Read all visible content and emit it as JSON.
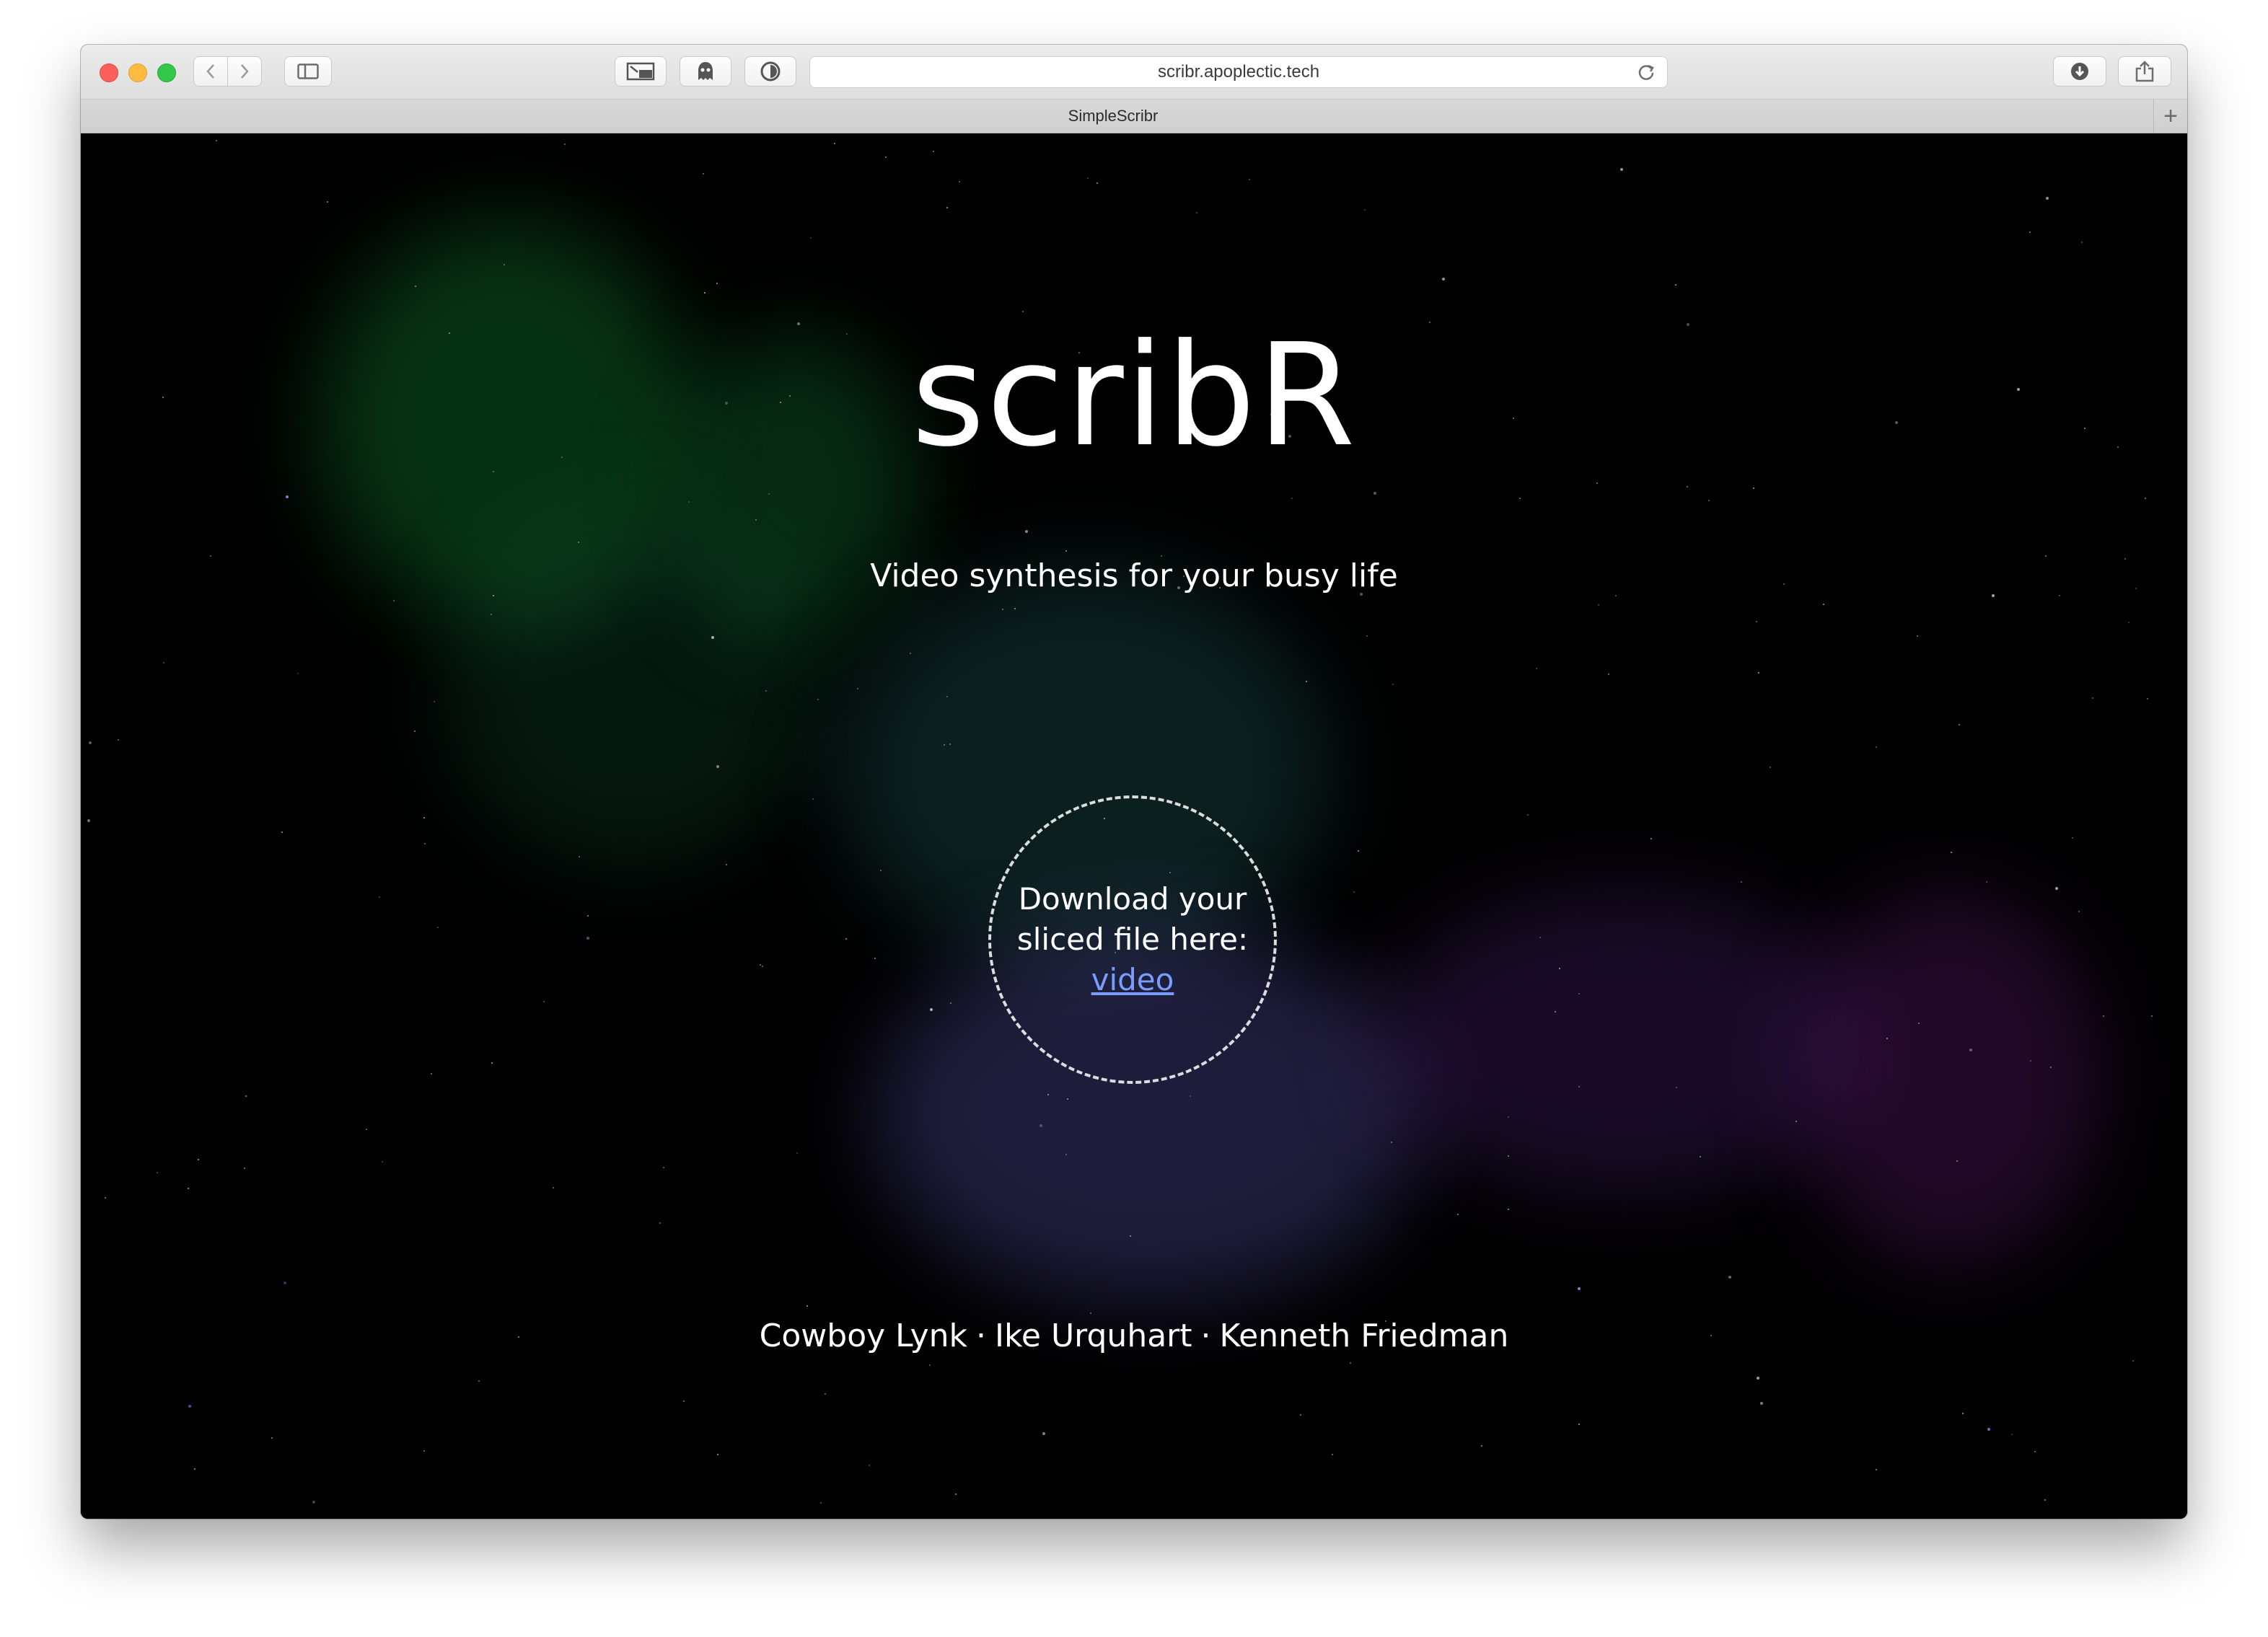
{
  "browser": {
    "url": "scribr.apoplectic.tech",
    "tab_title": "SimpleScribr",
    "new_tab_label": "+"
  },
  "page": {
    "title": "scribR",
    "tagline": "Video synthesis for your busy life",
    "download_line1": "Download your",
    "download_line2": "sliced file here:",
    "download_link": "video",
    "authors": [
      "Cowboy Lynk",
      "Ike Urquhart",
      "Kenneth Friedman"
    ],
    "author_separator": "·"
  },
  "colors": {
    "link": "#7b9cff",
    "background": "#000000"
  }
}
